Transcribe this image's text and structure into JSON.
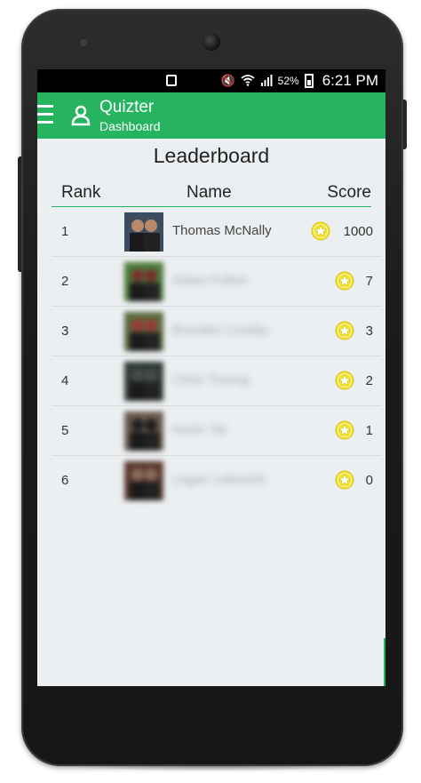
{
  "status_bar": {
    "battery": "52%",
    "time": "6:21 PM"
  },
  "app_bar": {
    "title": "Quizter",
    "subtitle": "Dashboard"
  },
  "leaderboard": {
    "title": "Leaderboard",
    "columns": [
      "Rank",
      "Name",
      "Score"
    ],
    "rows": [
      {
        "rank": "1",
        "name": "Thomas McNally",
        "score": "1000",
        "blurred": false
      },
      {
        "rank": "2",
        "name": "Adam Fulton",
        "score": "7",
        "blurred": true
      },
      {
        "rank": "3",
        "name": "Brenden Crosby",
        "score": "3",
        "blurred": true
      },
      {
        "rank": "4",
        "name": "Chris Truong",
        "score": "2",
        "blurred": true
      },
      {
        "rank": "5",
        "name": "Kevin Tai",
        "score": "1",
        "blurred": true
      },
      {
        "rank": "6",
        "name": "Logan Lebrecht",
        "score": "0",
        "blurred": true
      }
    ]
  },
  "colors": {
    "accent": "#27b461",
    "coin": "#f2e230",
    "background": "#eceff1"
  },
  "icons": {
    "menu": "menu-icon",
    "user": "user-icon",
    "coin": "star-coin-icon"
  }
}
